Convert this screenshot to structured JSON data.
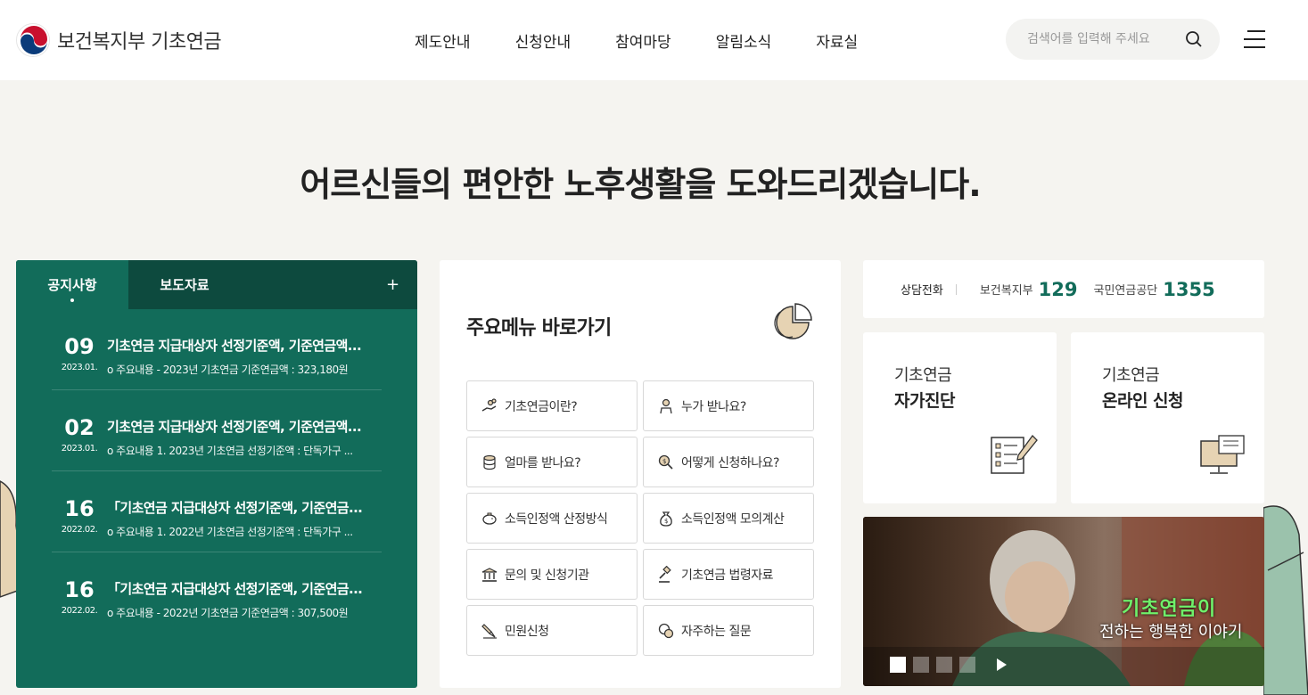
{
  "header": {
    "logo_org": "보건복지부",
    "logo_service": "기초연금",
    "nav": [
      "제도안내",
      "신청안내",
      "참여마당",
      "알림소식",
      "자료실"
    ],
    "search_placeholder": "검색어를 입력해 주세요"
  },
  "hero": {
    "prefix": "어르신들의 ",
    "emphasis": "편안한 노후생활",
    "suffix": "을 도와드리겠습니다."
  },
  "notice": {
    "tabs": [
      "공지사항",
      "보도자료"
    ],
    "active_tab": "공지사항",
    "more_label": "+",
    "items": [
      {
        "day": "09",
        "ym": "2023.01.",
        "title": "기초연금 지급대상자 선정기준액, 기준연금액...",
        "desc": "o 주요내용 - 2023년 기초연금 기준연금액 : 323,180원"
      },
      {
        "day": "02",
        "ym": "2023.01.",
        "title": "기초연금 지급대상자 선정기준액, 기준연금액...",
        "desc": "o 주요내용 1. 2023년 기초연금 선정기준액 : 단독가구 ..."
      },
      {
        "day": "16",
        "ym": "2022.02.",
        "title": "「기초연금 지급대상자 선정기준액, 기준연금...",
        "desc": "o 주요내용 1. 2022년 기초연금 선정기준액 : 단독가구 ..."
      },
      {
        "day": "16",
        "ym": "2022.02.",
        "title": "「기초연금 지급대상자 선정기준액, 기준연금...",
        "desc": "o 주요내용 - 2022년 기초연금 기준연금액 : 307,500원"
      }
    ]
  },
  "quick": {
    "title_bold": "주요메뉴",
    "title_rest": " 바로가기",
    "items": [
      {
        "label": "기초연금이란?",
        "icon": "hand-coins-icon"
      },
      {
        "label": "누가 받나요?",
        "icon": "person-icon"
      },
      {
        "label": "얼마를 받나요?",
        "icon": "coin-stack-icon"
      },
      {
        "label": "어떻게 신청하나요?",
        "icon": "search-money-icon"
      },
      {
        "label": "소득인정액 산정방식",
        "icon": "piggy-bank-icon"
      },
      {
        "label": "소득인정액 모의계산",
        "icon": "money-bag-icon"
      },
      {
        "label": "문의 및 신청기관",
        "icon": "building-icon"
      },
      {
        "label": "기초연금 법령자료",
        "icon": "gavel-icon"
      },
      {
        "label": "민원신청",
        "icon": "pen-icon"
      },
      {
        "label": "자주하는 질문",
        "icon": "chat-icon"
      }
    ]
  },
  "consult": {
    "label": "상담전화",
    "org1": "보건복지부",
    "num1": "129",
    "org2": "국민연금공단",
    "num2": "1355"
  },
  "cards": [
    {
      "line1": "기초연금",
      "line2": "자가진단",
      "icon": "checklist-icon"
    },
    {
      "line1": "기초연금",
      "line2": "온라인 신청",
      "icon": "computer-icon"
    }
  ],
  "video": {
    "caption1": "기초연금이",
    "caption2": "전하는 행복한 이야기",
    "slides": 4,
    "active_slide": 1
  },
  "colors": {
    "brand_green": "#126c5a",
    "brand_green_dark": "#0d4a3e",
    "bg": "#f5f4f0"
  }
}
